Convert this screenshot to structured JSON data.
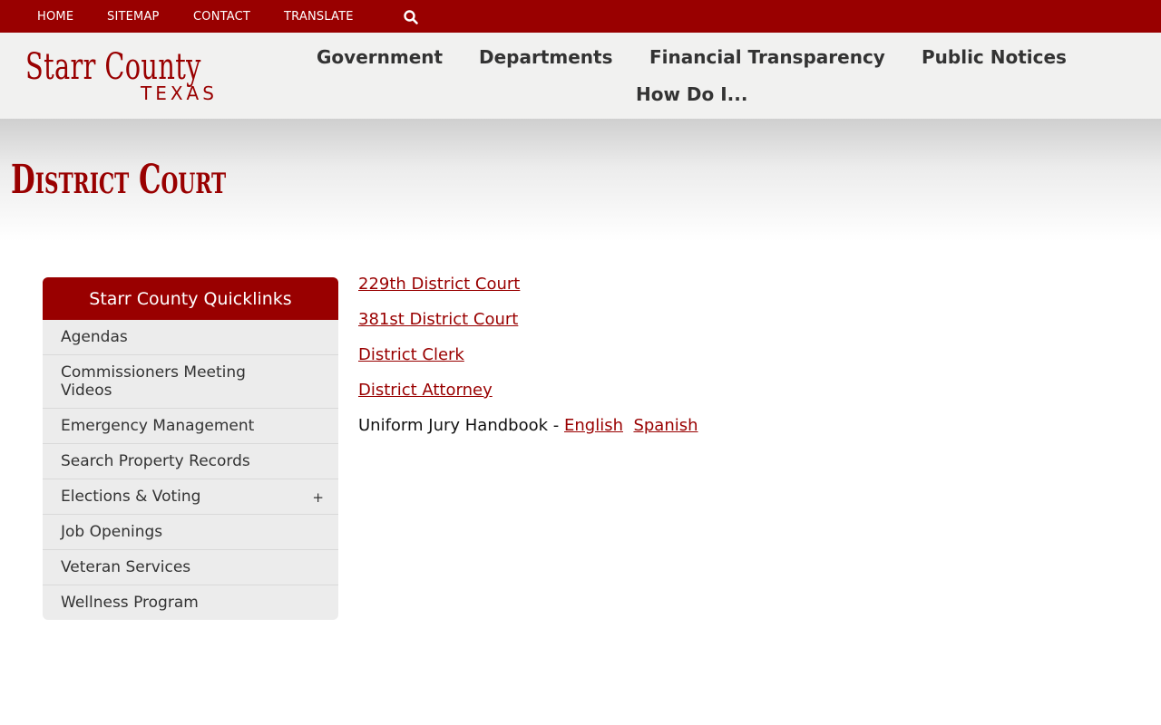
{
  "utility_nav": {
    "items": [
      "HOME",
      "SITEMAP",
      "CONTACT",
      "TRANSLATE"
    ],
    "search_icon": "search-icon"
  },
  "logo": {
    "main": "Starr County",
    "sub": "TEXAS"
  },
  "main_nav": {
    "items": [
      "Government",
      "Departments",
      "Financial Transparency",
      "Public Notices",
      "How Do I..."
    ]
  },
  "page": {
    "title": "District Court"
  },
  "sidebar": {
    "title": "Starr County Quicklinks",
    "items": [
      {
        "label": "Agendas"
      },
      {
        "label": "Commissioners Meeting Videos"
      },
      {
        "label": "Emergency Management"
      },
      {
        "label": "Search Property Records"
      },
      {
        "label": "Elections & Voting",
        "expand": "+"
      },
      {
        "label": "Job Openings"
      },
      {
        "label": "Veteran Services"
      },
      {
        "label": "Wellness Program"
      }
    ]
  },
  "content": {
    "links": [
      "229th District Court",
      "381st District Court",
      "District Clerk",
      "District Attorney"
    ],
    "handbook": {
      "prefix": "Uniform Jury Handbook - ",
      "english": "English",
      "spanish": "Spanish"
    }
  },
  "colors": {
    "brand": "#990000",
    "header_bg": "#f1f1f0",
    "sidebar_bg": "#ececec"
  }
}
